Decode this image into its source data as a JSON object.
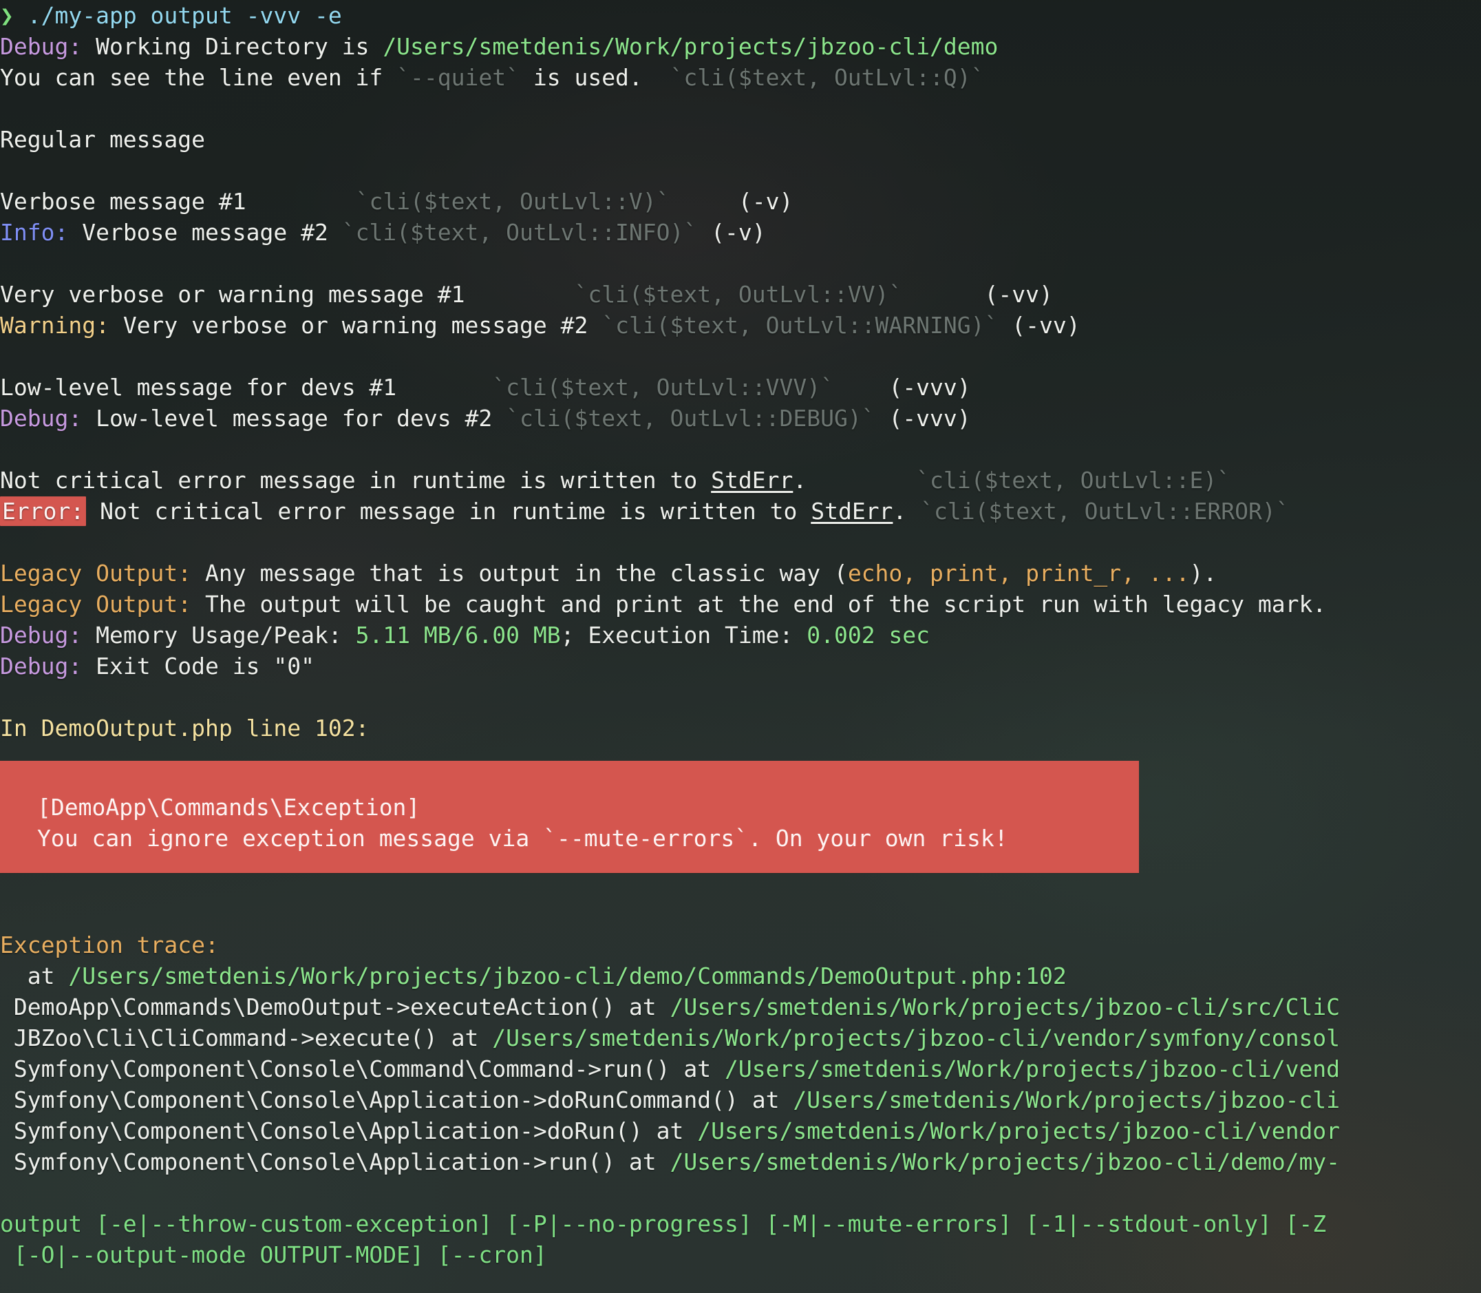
{
  "terminal": {
    "background_color": "#2a3331",
    "foreground_color": "#e8eae6",
    "prompt_symbol": "❯",
    "font_size_px": 33,
    "line_height_px": 45
  },
  "colors": {
    "green": "#8ce58c",
    "cyan": "#93d8ef",
    "blue": "#7f8ff4",
    "magenta": "#c79ae0",
    "yellow": "#f2d08a",
    "orange": "#e8ae60",
    "dim_comment": "#6d7672",
    "error_bg": "#d4564f",
    "error_fg": "#fdf4f3",
    "light_yellow": "#f4e1a0"
  },
  "command": {
    "binary": "./my-app",
    "subcommand": "output",
    "flags": "-vvv -e",
    "full": "./my-app output -vvv -e"
  },
  "lines": {
    "debug_workdir_label": "Debug:",
    "debug_workdir_text": " Working Directory is ",
    "debug_workdir_path": "/Users/smetdenis/Work/projects/jbzoo-cli/demo",
    "quiet_line_a": "You can see the line even if ",
    "quiet_line_flag": "`--quiet`",
    "quiet_line_b": " is used.  ",
    "quiet_line_hint": "`cli($text, OutLvl::Q)`",
    "regular_message": "Regular message",
    "verbose1_text": "Verbose message #1",
    "verbose1_hint": "`cli($text, OutLvl::V)`",
    "verbose1_flag": "(-v)",
    "info_label": "Info:",
    "info_text": " Verbose message #2 ",
    "info_hint": "`cli($text, OutLvl::INFO)`",
    "info_flag": "(-v)",
    "vverbose1_text": "Very verbose or warning message #1",
    "vverbose1_hint": "`cli($text, OutLvl::VV)`",
    "vverbose1_flag": "(-vv)",
    "warning_label": "Warning:",
    "warning_text": " Very verbose or warning message #2 ",
    "warning_hint": "`cli($text, OutLvl::WARNING)`",
    "warning_flag": "(-vv)",
    "lowlevel1_text": "Low-level message for devs #1",
    "lowlevel1_hint": "`cli($text, OutLvl::VVV)`",
    "lowlevel1_flag": "(-vvv)",
    "debug_label": "Debug:",
    "debug_text": " Low-level message for devs #2 ",
    "debug_hint": "`cli($text, OutLvl::DEBUG)`",
    "debug_flag": "(-vvv)",
    "stderr1_a": "Not critical error message in runtime is written to ",
    "stderr1_b": "StdErr",
    "stderr1_c": ".",
    "stderr1_hint": "`cli($text, OutLvl::E)`",
    "error_label": "Error:",
    "stderr2_a": " Not critical error message in runtime is written to ",
    "stderr2_b": "StdErr",
    "stderr2_c": ". ",
    "stderr2_hint": "`cli($text, OutLvl::ERROR)`",
    "legacy1_label": "Legacy Output:",
    "legacy1_a": " Any message that is output in the classic way (",
    "legacy1_fns": "echo, print, print_r, ...",
    "legacy1_b": ").",
    "legacy2_label": "Legacy Output:",
    "legacy2_text": " The output will be caught and print at the end of the script run with legacy mark.",
    "mem_label": "Debug:",
    "mem_a": " Memory Usage/Peak: ",
    "mem_value": "5.11 MB/6.00 MB",
    "mem_b": "; Execution Time: ",
    "mem_time": "0.002 sec",
    "exit_label": "Debug:",
    "exit_text": " Exit Code is \"0\"",
    "in_file_line": "In DemoOutput.php line 102:",
    "exception_class": "[DemoApp\\Commands\\Exception]",
    "exception_message": "You can ignore exception message via `--mute-errors`. On your own risk!",
    "exception_trace_header": "Exception trace:",
    "trace_at_prefix": "  at ",
    "trace_at_path": "/Users/smetdenis/Work/projects/jbzoo-cli/demo/Commands/DemoOutput.php:102",
    "trace_1_call": " DemoApp\\Commands\\DemoOutput->executeAction() at ",
    "trace_1_path": "/Users/smetdenis/Work/projects/jbzoo-cli/src/CliC",
    "trace_2_call": " JBZoo\\Cli\\CliCommand->execute() at ",
    "trace_2_path": "/Users/smetdenis/Work/projects/jbzoo-cli/vendor/symfony/consol",
    "trace_3_call": " Symfony\\Component\\Console\\Command\\Command->run() at ",
    "trace_3_path": "/Users/smetdenis/Work/projects/jbzoo-cli/vend",
    "trace_4_call": " Symfony\\Component\\Console\\Application->doRunCommand() at ",
    "trace_4_path": "/Users/smetdenis/Work/projects/jbzoo-cli",
    "trace_5_call": " Symfony\\Component\\Console\\Application->doRun() at ",
    "trace_5_path": "/Users/smetdenis/Work/projects/jbzoo-cli/vendor",
    "trace_6_call": " Symfony\\Component\\Console\\Application->run() at ",
    "trace_6_path": "/Users/smetdenis/Work/projects/jbzoo-cli/demo/my-",
    "usage_line_1": "output [-e|--throw-custom-exception] [-P|--no-progress] [-M|--mute-errors] [-1|--stdout-only] [-Z",
    "usage_line_2": " [-O|--output-mode OUTPUT-MODE] [--cron]"
  }
}
